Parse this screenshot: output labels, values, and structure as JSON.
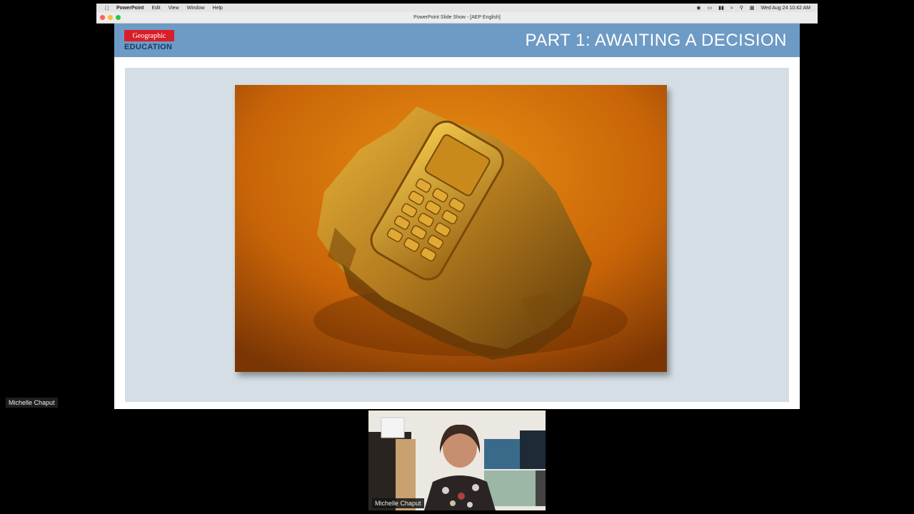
{
  "menubar": {
    "apple_icon": "apple-icon",
    "app_name": "PowerPoint",
    "items": [
      "Edit",
      "View",
      "Window",
      "Help"
    ],
    "datetime": "Wed Aug 24  10:42 AM"
  },
  "window": {
    "title": "PowerPoint Slide Show - [AEP English]"
  },
  "slide": {
    "logo_top": "Geographic",
    "logo_bottom": "EDUCATION",
    "title": "PART 1: AWAITING A DECISION",
    "photo_icon": "fossilized-phone-image"
  },
  "participants": {
    "screen_sharer": "Michelle Chaput",
    "camera_name": "Michelle Chaput"
  },
  "colors": {
    "header": "#6e9bc5",
    "panel": "#d4dee4",
    "logo_red": "#d81e29"
  }
}
